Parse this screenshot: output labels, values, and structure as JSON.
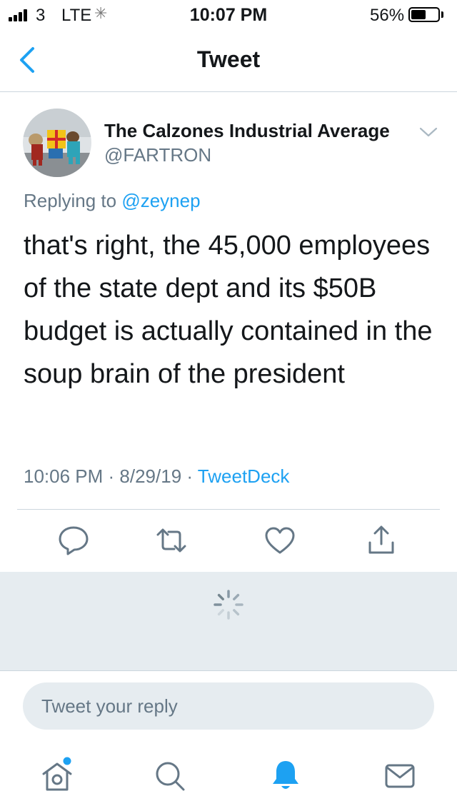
{
  "status_bar": {
    "carrier": "3",
    "network": "LTE",
    "time": "10:07 PM",
    "battery": "56%",
    "battery_level": 0.56
  },
  "header": {
    "title": "Tweet",
    "back_icon": "chevron-left-icon"
  },
  "tweet": {
    "display_name": "The Calzones Industrial Average",
    "handle": "@FARTRON",
    "replying_prefix": "Replying to ",
    "replying_to": "@zeynep",
    "text": "that's right, the 45,000 employees of the state dept and its $50B budget is actually contained in the soup brain of the president",
    "time": "10:06 PM",
    "separator": " · ",
    "date": "8/29/19",
    "source": "TweetDeck"
  },
  "actions": [
    {
      "name": "reply",
      "icon": "reply-icon"
    },
    {
      "name": "retweet",
      "icon": "retweet-icon"
    },
    {
      "name": "like",
      "icon": "heart-icon"
    },
    {
      "name": "share",
      "icon": "share-icon"
    }
  ],
  "reply_box": {
    "placeholder": "Tweet your reply"
  },
  "tab_bar": [
    {
      "name": "home",
      "icon": "home-icon",
      "has_notification_dot": true
    },
    {
      "name": "search",
      "icon": "search-icon"
    },
    {
      "name": "notifications",
      "icon": "bell-icon",
      "active": true
    },
    {
      "name": "messages",
      "icon": "envelope-icon"
    }
  ],
  "colors": {
    "accent": "#1da1f2",
    "secondary_text": "#657786",
    "divider": "#ccd6dd",
    "gray_bg": "#e6ecf0"
  }
}
